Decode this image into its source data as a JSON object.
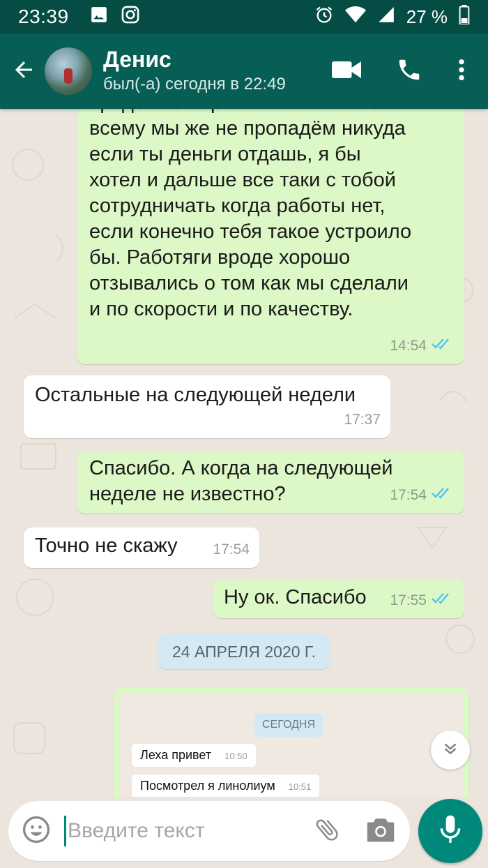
{
  "status_bar": {
    "time": "23:39",
    "battery": "27 %",
    "left_icons": [
      "image-icon",
      "instagram-icon"
    ],
    "right_icons": [
      "alarm-icon",
      "wifi-icon",
      "signal-icon",
      "battery-icon"
    ]
  },
  "header": {
    "contact_name": "Денис",
    "last_seen": "был(-а) сегодня в 22:49",
    "icons": [
      "back-arrow-icon",
      "video-call-icon",
      "phone-icon",
      "more-vert-icon"
    ]
  },
  "messages": [
    {
      "direction": "out",
      "text": "вроде все нормально. Плюс ко\nвсему мы же не пропадём никуда\nесли ты деньги отдашь, я бы\nхотел и дальше все таки с тобой\nсотрудничать когда работы нет,\nесли конечно тебя такое устроило\nбы. Работяги вроде хорошо\nотзывались о том как мы сделали\nи по скорости и по качеству.",
      "time": "14:54",
      "read": true
    },
    {
      "direction": "in",
      "text": "Остальные на следующей недели",
      "time": "17:37"
    },
    {
      "direction": "out",
      "text": "Спасибо. А когда на следующей\nнеделе не известно?",
      "time": "17:54",
      "read": true
    },
    {
      "direction": "in",
      "text": "Точно не скажу",
      "time": "17:54"
    },
    {
      "direction": "out",
      "text": "Ну ок. Спасибо",
      "time": "17:55",
      "read": true
    }
  ],
  "date_separator": "24 АПРЕЛЯ 2020 Г.",
  "screenshot_message": {
    "chip": "СЕГОДНЯ",
    "lines": [
      {
        "text": "Леха привет",
        "time": "10:50"
      },
      {
        "text": "Посмотрел я линолиум",
        "time": "10:51"
      }
    ]
  },
  "input": {
    "placeholder": "Введите текст"
  },
  "colors": {
    "status_bar": "#054d44",
    "app_bar": "#075e54",
    "outgoing_bubble": "#dcf8c6",
    "incoming_bubble": "#ffffff",
    "read_ticks": "#4fc3f7",
    "accent": "#00897b",
    "chat_background": "#ece5dd"
  }
}
